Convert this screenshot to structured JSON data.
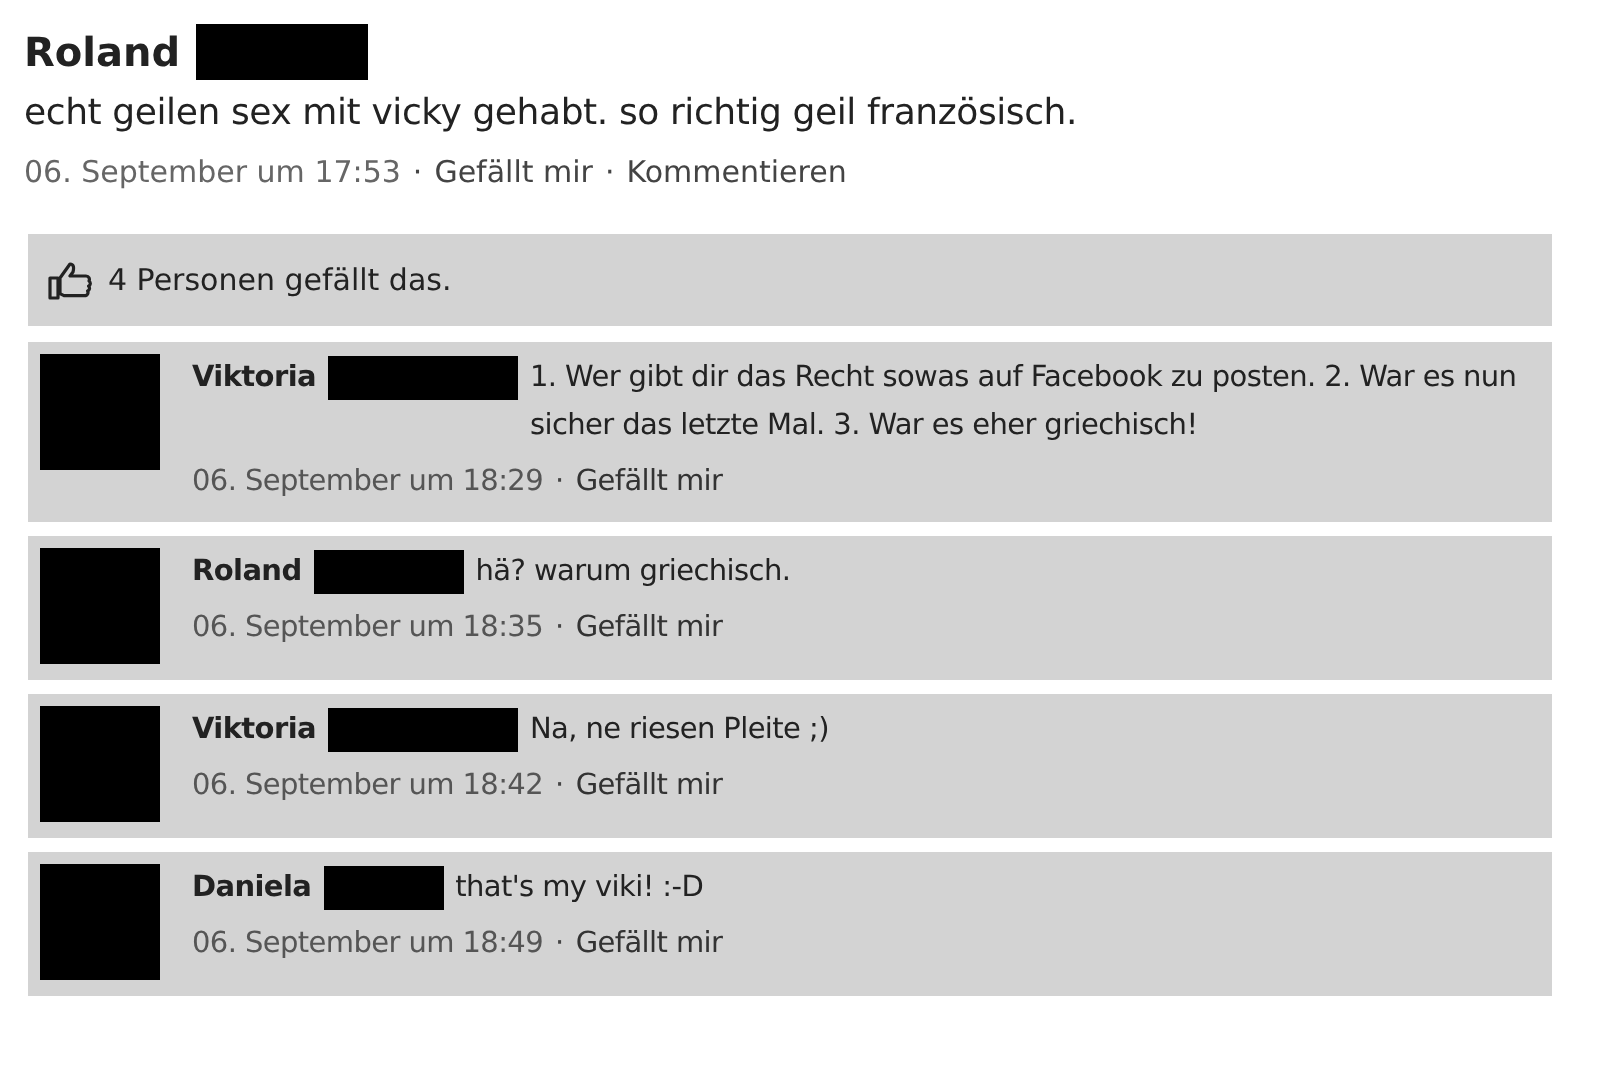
{
  "post": {
    "author": "Roland",
    "text": "echt geilen sex mit vicky gehabt. so richtig geil französisch.",
    "time": "06. September um 17:53",
    "actions": [
      {
        "separator": "·",
        "label": "Gefällt mir"
      },
      {
        "separator": "·",
        "label": "Kommentieren"
      }
    ]
  },
  "likes": {
    "text": "4 Personen gefällt das."
  },
  "comments": [
    {
      "author": "Viktoria",
      "text": "1. Wer gibt dir das Recht sowas auf Facebook zu posten. 2. War es nun sicher das letzte Mal. 3. War es eher griechisch!",
      "time": "06. September um 18:29",
      "separator": "·",
      "action": "Gefällt mir"
    },
    {
      "author": "Roland",
      "text": "hä? warum griechisch.",
      "time": "06. September um 18:35",
      "separator": "·",
      "action": "Gefällt mir"
    },
    {
      "author": "Viktoria",
      "text": "Na, ne riesen Pleite ;)",
      "time": "06. September um 18:42",
      "separator": "·",
      "action": "Gefällt mir"
    },
    {
      "author": "Daniela",
      "text": "that's my viki! :-D",
      "time": "06. September um 18:49",
      "separator": "·",
      "action": "Gefällt mir"
    }
  ]
}
